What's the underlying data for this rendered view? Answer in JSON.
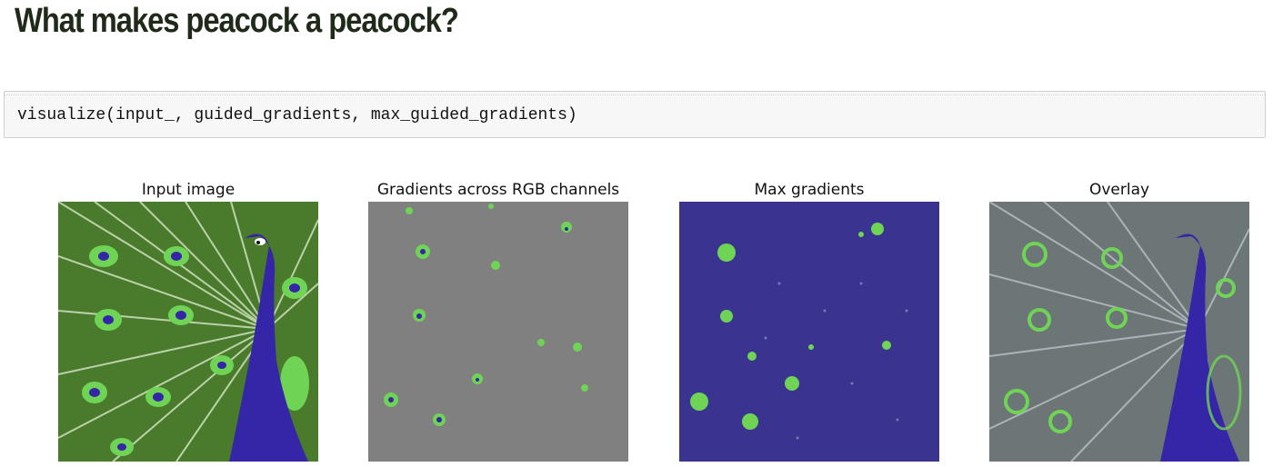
{
  "notebook": {
    "heading": "What makes peacock a peacock?",
    "code": "visualize(input_, guided_gradients, max_guided_gradients)"
  },
  "figure": {
    "panels": [
      {
        "title": "Input image"
      },
      {
        "title": "Gradients across RGB channels"
      },
      {
        "title": "Max gradients"
      },
      {
        "title": "Overlay"
      }
    ]
  },
  "colors": {
    "heading": "#1f2a1a",
    "code_background": "#f7f7f7",
    "gradient_gray": "#7f807f",
    "max_background": "#3a3490",
    "highlight_green": "#6fd455",
    "peacock_blue": "#3526a8"
  }
}
